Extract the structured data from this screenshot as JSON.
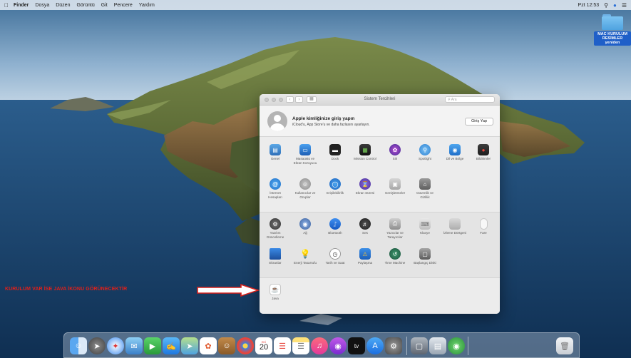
{
  "menubar": {
    "apple": "",
    "items": [
      "Finder",
      "Dosya",
      "Düzen",
      "Görüntü",
      "Git",
      "Pencere",
      "Yardım"
    ],
    "clock": "Pzt 12:53"
  },
  "desktop": {
    "folder_label_line1": "MAC KURULUM",
    "folder_label_line2": "RESİMLER yeniden"
  },
  "window": {
    "title": "Sistem Tercihleri",
    "search_placeholder": "Ara",
    "account": {
      "title": "Apple kimliğinize giriş yapın",
      "subtitle": "iCloud'u, App Store'u ve daha fazlasını ayarlayın.",
      "signin_button": "Giriş Yap"
    },
    "row1": [
      "Genel",
      "Masaüstü ve Ekran Koruyucu",
      "Dock",
      "Mission Control",
      "Siri",
      "Spotlight",
      "Dil ve Bölge",
      "Bildirimler"
    ],
    "row2": [
      "İnternet Hesapları",
      "Kullanıcılar ve Gruplar",
      "Erişilebilirlik",
      "Ekran Süresi",
      "Genişletmeler",
      "Güvenlik ve Gizlilik"
    ],
    "row3": [
      "Yazılım Güncelleme",
      "Ağ",
      "Bluetooth",
      "Ses",
      "Yazıcılar ve Tarayıcılar",
      "Klavye",
      "İzleme Dörtgeni",
      "Fare"
    ],
    "row4": [
      "Ekranlar",
      "Enerji Tasarrufu",
      "Tarih ve Saat",
      "Paylaşma",
      "Time Machine",
      "Başlangıç Diski"
    ],
    "row5": [
      "Java"
    ]
  },
  "annotation": {
    "text": "KURULUM VAR İSE JAVA İKONU GÖRÜNECEKTİR",
    "color": "#e0201a"
  },
  "dock": {
    "calendar_day": "20",
    "calendar_month": "EKİ"
  }
}
